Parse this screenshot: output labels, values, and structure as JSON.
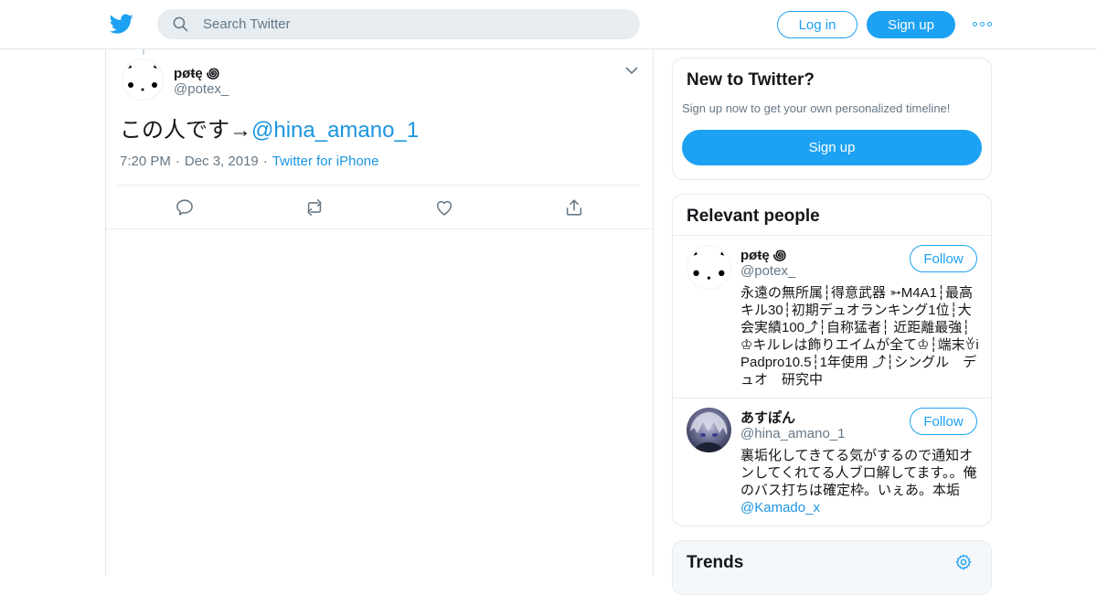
{
  "colors": {
    "accent": "#1da1f2",
    "link": "#1b95e0",
    "muted": "#657786",
    "text": "#14171a",
    "border": "#e6ecf0",
    "search_bg": "#e6ecf0"
  },
  "topbar": {
    "logo_icon": "twitter-bird-icon",
    "search_placeholder": "Search Twitter",
    "login_label": "Log in",
    "signup_label": "Sign up",
    "more_icon": "more-dots-icon"
  },
  "tweet": {
    "name": "pøŧę ꩜",
    "handle": "@potex_",
    "text_prefix": "この人です→",
    "text_mention": "@hina_amano_1",
    "time": "7:20 PM",
    "separator": "·",
    "date": "Dec 3, 2019",
    "source": "Twitter for iPhone",
    "actions": [
      "reply-icon",
      "retweet-icon",
      "like-icon",
      "share-icon"
    ]
  },
  "sidebar": {
    "new_to_twitter": {
      "title": "New to Twitter?",
      "subtitle": "Sign up now to get your own personalized timeline!",
      "button": "Sign up"
    },
    "relevant_people": {
      "title": "Relevant people",
      "people": [
        {
          "name": "pøŧę ꩜",
          "handle": "@potex_",
          "follow": "Follow",
          "bio": "永遠の無所属┆得意武器 ➳M4A1┆最高キル30┆初期デュオランキング1位┆大会実績100⤴︎┆自称猛者┆ 近距離最強┆♔キルレは飾りエイムが全て♔┆端末ꈊiPadpro10.5┆1年使用 ⤴︎┆シングル　デュオ　研究中",
          "bio_link": ""
        },
        {
          "name": "あすぽん",
          "handle": "@hina_amano_1",
          "follow": "Follow",
          "bio": "裏垢化してきてる気がするので通知オンしてくれてる人ブロ解してます。。俺のバス打ちは確定枠。いぇあ。本垢",
          "bio_link": "@Kamado_x"
        }
      ]
    },
    "trends": {
      "title": "Trends",
      "settings_icon": "gear-icon"
    }
  }
}
